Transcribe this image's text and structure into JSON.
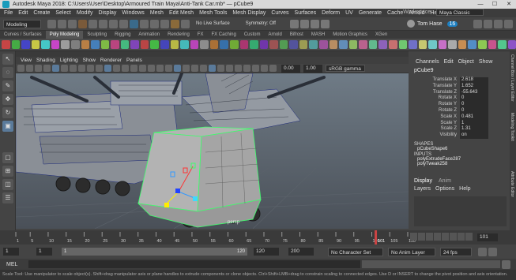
{
  "titlebar": {
    "title": "Autodesk Maya 2018: C:\\Users\\User\\Desktop\\Armoured Train Maya\\Anti-Tank Car.mb* — pCube9",
    "minimize": "—",
    "maximize": "☐",
    "close": "✕"
  },
  "menu": [
    "File",
    "Edit",
    "Create",
    "Select",
    "Modify",
    "Display",
    "Windows",
    "Mesh",
    "Edit Mesh",
    "Mesh Tools",
    "Mesh Display",
    "Curves",
    "Surfaces",
    "Deform",
    "UV",
    "Generate",
    "Cache",
    "Arnold",
    "Help"
  ],
  "workspace": {
    "label": "Workspace :",
    "value": "Maya Classic"
  },
  "statusline": {
    "mode": "Modeling",
    "live_surface": "No Live Surface",
    "symmetry": "Symmetry: Off",
    "user": "Tom Hase",
    "badge": "16"
  },
  "shelf_tabs": [
    "Curves / Surfaces",
    "Poly Modeling",
    "Sculpting",
    "Rigging",
    "Animation",
    "Rendering",
    "FX",
    "FX Caching",
    "Custom",
    "Arnold",
    "Bifrost",
    "MASH",
    "Motion Graphics",
    "XGen"
  ],
  "shelf_active": "Poly Modeling",
  "panel_menu": [
    "View",
    "Shading",
    "Lighting",
    "Show",
    "Renderer",
    "Panels"
  ],
  "panel_tools": {
    "field1": "0.00",
    "field2": "1.00",
    "colorspace": "sRGB gamma"
  },
  "viewport": {
    "camera_label": "persp"
  },
  "channel_box": {
    "menu": [
      "Channels",
      "Edit",
      "Object",
      "Show"
    ],
    "object": "pCube9",
    "attrs": [
      {
        "name": "Translate X",
        "value": "2.618"
      },
      {
        "name": "Translate Y",
        "value": "1.652"
      },
      {
        "name": "Translate Z",
        "value": "-55.643"
      },
      {
        "name": "Rotate X",
        "value": "0"
      },
      {
        "name": "Rotate Y",
        "value": "0"
      },
      {
        "name": "Rotate Z",
        "value": "0"
      },
      {
        "name": "Scale X",
        "value": "0.481"
      },
      {
        "name": "Scale Y",
        "value": "1"
      },
      {
        "name": "Scale Z",
        "value": "1.31"
      },
      {
        "name": "Visibility",
        "value": "on"
      }
    ],
    "shapes_header": "SHAPES",
    "shape": "pCubeShape6",
    "inputs_header": "INPUTS",
    "inputs": [
      "polyExtrudeFace287",
      "polyTweak258"
    ],
    "layer_tabs": [
      "Display",
      "Anim"
    ],
    "layer_menu": [
      "Layers",
      "Options",
      "Help"
    ]
  },
  "side_tabs": [
    "Channel Box / Layer Editor",
    "Modeling Toolkit",
    "Attribute Editor"
  ],
  "timeline": {
    "ticks": [
      "1",
      "5",
      "10",
      "15",
      "20",
      "25",
      "30",
      "35",
      "40",
      "45",
      "50",
      "55",
      "60",
      "65",
      "70",
      "75",
      "80",
      "85",
      "90",
      "95",
      "100",
      "105",
      "110"
    ],
    "current": "101",
    "frame_field": "101"
  },
  "range": {
    "start": "1",
    "start2": "1",
    "slider_start": "1",
    "slider_end": "120",
    "end": "120",
    "end2": "200",
    "character_set": "No Character Set",
    "anim_layer": "No Anim Layer",
    "fps": "24 fps"
  },
  "mel": {
    "label": "MEL"
  },
  "help_line": "Scale Tool: Use manipulator to scale object(s). Shift+drag manipulator axis or plane handles to extrude components or clone objects. Ctrl+Shift+LMB+drag to constrain scaling to connected edges. Use D or INSERT to change the pivot position and axis orientation."
}
